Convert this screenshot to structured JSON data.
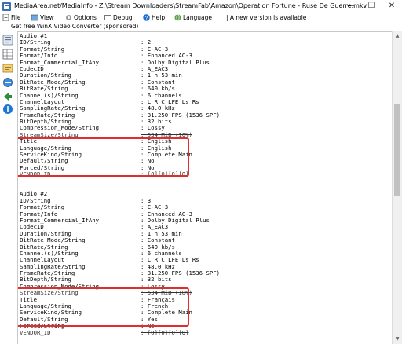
{
  "window": {
    "title": "MediaArea.net/MediaInfo - Z:\\Stream Downloaders\\StreamFab\\Amazon\\Operation Fortune - Ruse De Guerre.mkv",
    "minimize": "—",
    "maximize": "☐",
    "close": "✕"
  },
  "menu": {
    "file": "File",
    "view": "View",
    "options": "Options",
    "debug": "Debug",
    "help": "Help",
    "language": "Language",
    "notice": "| A new version is available"
  },
  "sponsor": "Get free WinX Video Converter (sponsored)",
  "audio1": [
    {
      "k": "Audio #1",
      "v": ""
    },
    {
      "k": "ID/String",
      "v": ": 2"
    },
    {
      "k": "Format/String",
      "v": ": E-AC-3"
    },
    {
      "k": "Format/Info",
      "v": ": Enhanced AC-3"
    },
    {
      "k": "Format_Commercial_IfAny",
      "v": ": Dolby Digital Plus"
    },
    {
      "k": "CodecID",
      "v": ": A_EAC3"
    },
    {
      "k": "Duration/String",
      "v": ": 1 h 53 min"
    },
    {
      "k": "BitRate_Mode/String",
      "v": ": Constant"
    },
    {
      "k": "BitRate/String",
      "v": ": 640 kb/s"
    },
    {
      "k": "Channel(s)/String",
      "v": ": 6 channels"
    },
    {
      "k": "ChannelLayout",
      "v": ": L R C LFE Ls Rs"
    },
    {
      "k": "SamplingRate/String",
      "v": ": 48.0 kHz"
    },
    {
      "k": "FrameRate/String",
      "v": ": 31.250 FPS (1536 SPF)"
    },
    {
      "k": "BitDepth/String",
      "v": ": 32 bits"
    },
    {
      "k": "Compression_Mode/String",
      "v": ": Lossy"
    },
    {
      "k": "StreamSize/String",
      "v": ": 534 MiB (10%)"
    },
    {
      "k": "Title",
      "v": ": English"
    },
    {
      "k": "Language/String",
      "v": ": English"
    },
    {
      "k": "ServiceKind/String",
      "v": ": Complete Main"
    },
    {
      "k": "Default/String",
      "v": ": No"
    },
    {
      "k": "Forced/String",
      "v": ": No"
    },
    {
      "k": "VENDOR_ID",
      "v": ": [0][0][0][0]"
    }
  ],
  "audio2": [
    {
      "k": "Audio #2",
      "v": ""
    },
    {
      "k": "ID/String",
      "v": ": 3"
    },
    {
      "k": "Format/String",
      "v": ": E-AC-3"
    },
    {
      "k": "Format/Info",
      "v": ": Enhanced AC-3"
    },
    {
      "k": "Format_Commercial_IfAny",
      "v": ": Dolby Digital Plus"
    },
    {
      "k": "CodecID",
      "v": ": A_EAC3"
    },
    {
      "k": "Duration/String",
      "v": ": 1 h 53 min"
    },
    {
      "k": "BitRate_Mode/String",
      "v": ": Constant"
    },
    {
      "k": "BitRate/String",
      "v": ": 640 kb/s"
    },
    {
      "k": "Channel(s)/String",
      "v": ": 6 channels"
    },
    {
      "k": "ChannelLayout",
      "v": ": L R C LFE Ls Rs"
    },
    {
      "k": "SamplingRate/String",
      "v": ": 48.0 kHz"
    },
    {
      "k": "FrameRate/String",
      "v": ": 31.250 FPS (1536 SPF)"
    },
    {
      "k": "BitDepth/String",
      "v": ": 32 bits"
    },
    {
      "k": "Compression_Mode/String",
      "v": ": Lossy"
    },
    {
      "k": "StreamSize/String",
      "v": ": 534 MiB (10%)"
    },
    {
      "k": "Title",
      "v": ": Français"
    },
    {
      "k": "Language/String",
      "v": ": French"
    },
    {
      "k": "ServiceKind/String",
      "v": ": Complete Main"
    },
    {
      "k": "Default/String",
      "v": ": Yes"
    },
    {
      "k": "Forced/String",
      "v": ": No"
    },
    {
      "k": "VENDOR_ID",
      "v": ": [0][0][0][0]"
    }
  ],
  "colors": {
    "highlight": "#e02d2d"
  },
  "sidebar_icons": [
    "easy-view-icon",
    "sheet-view-icon",
    "tree-view-icon",
    "html-view-icon",
    "export-icon",
    "info-icon"
  ]
}
